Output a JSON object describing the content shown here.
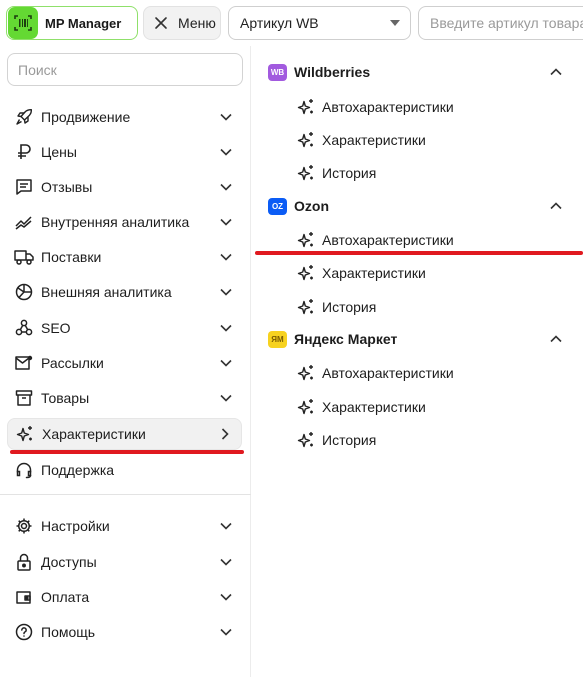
{
  "topbar": {
    "brand_name": "MP Manager",
    "menu_label": "Меню",
    "article_select_value": "Артикул WB",
    "article_input_placeholder": "Введите артикул товара"
  },
  "sidebar": {
    "search_placeholder": "Поиск",
    "items": [
      {
        "label": "Продвижение",
        "icon": "rocket-icon"
      },
      {
        "label": "Цены",
        "icon": "ruble-icon"
      },
      {
        "label": "Отзывы",
        "icon": "comment-icon"
      },
      {
        "label": "Внутренняя аналитика",
        "icon": "trend-icon"
      },
      {
        "label": "Поставки",
        "icon": "truck-icon"
      },
      {
        "label": "Внешняя аналитика",
        "icon": "pie-icon"
      },
      {
        "label": "SEO",
        "icon": "link-icon"
      },
      {
        "label": "Рассылки",
        "icon": "mail-icon"
      },
      {
        "label": "Товары",
        "icon": "box-icon"
      },
      {
        "label": "Характеристики",
        "icon": "sparkle-icon",
        "active": true
      },
      {
        "label": "Поддержка",
        "icon": "headset-icon"
      }
    ],
    "bottom_items": [
      {
        "label": "Настройки",
        "icon": "gear-icon"
      },
      {
        "label": "Доступы",
        "icon": "lock-icon"
      },
      {
        "label": "Оплата",
        "icon": "wallet-icon"
      },
      {
        "label": "Помощь",
        "icon": "help-icon"
      }
    ]
  },
  "panel": {
    "marketplaces": [
      {
        "badge": "WB",
        "name": "Wildberries",
        "badge_color": "#a25adf",
        "items": [
          "Автохарактеристики",
          "Характеристики",
          "История"
        ]
      },
      {
        "badge": "OZ",
        "name": "Ozon",
        "badge_color": "#0b5cf5",
        "items": [
          "Автохарактеристики",
          "Характеристики",
          "История"
        ]
      },
      {
        "badge": "ЯМ",
        "name": "Яндекс Маркет",
        "badge_color": "#f7d21f",
        "items": [
          "Автохарактеристики",
          "Характеристики",
          "История"
        ]
      }
    ]
  },
  "colors": {
    "brand_green": "#64d933",
    "highlight_red": "#e0191f"
  }
}
